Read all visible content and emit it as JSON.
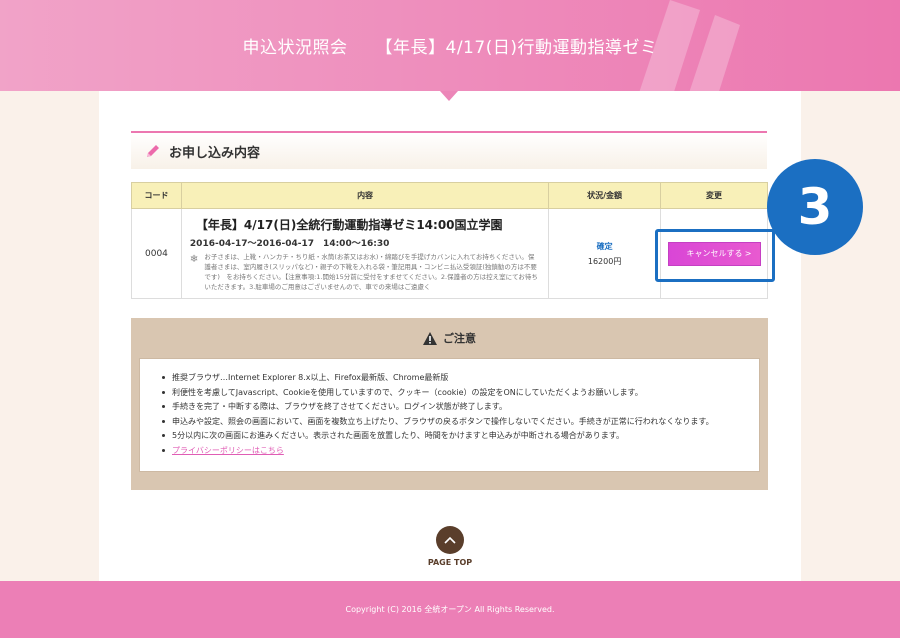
{
  "header": {
    "title_part1": "申込状況照会",
    "title_part2": "【年長】4/17(日)行動運動指導ゼミ"
  },
  "section": {
    "title": "お申し込み内容"
  },
  "table": {
    "headers": [
      "コード",
      "内容",
      "状況/金額",
      "変更"
    ],
    "rows": [
      {
        "code": "0004",
        "title": "【年長】4/17(日)全統行動運動指導ゼミ14:00国立学園",
        "date": "2016-04-17～2016-04-17　14:00～16:30",
        "note": "お子さまは、上靴・ハンカチ・ちり紙・水筒(お茶又はお水)・綿踏びを手提げカバンに入れてお持ちください。保護者さまは、室内履き(スリッパなど)・親子の下靴を入れる袋・筆記用具・コンビニ払込受領証(独鎮勧の方は不要です)　をお持ちください。【注意事項:1.開始15分前に受付をすませてください。2.保護者の方は控え室にてお待ちいただきます。3.駐車場のご用意はございませんので、車での来場はご遠慮く",
        "status": "確定",
        "amount": "16200円",
        "button_label": "キャンセルする"
      }
    ]
  },
  "badge": {
    "number": "3"
  },
  "notice": {
    "title": "ご注意",
    "items": [
      "推奨ブラウザ…Internet Explorer 8.x以上、Firefox最新版、Chrome最新版",
      "利便性を考慮してJavascript、Cookieを使用していますので、クッキー（cookie）の設定をONにしていただくようお願いします。",
      "手続きを完了・中断する際は、ブラウザを終了させてください。ログイン状態が終了します。",
      "申込みや設定、照会の画面において、画面を複数立ち上げたり、ブラウザの戻るボタンで操作しないでください。手続きが正常に行われなくなります。",
      "5分以内に次の画面にお進みください。表示された画面を放置したり、時間をかけますと申込みが中断される場合があります。"
    ],
    "privacy_link": "プライバシーポリシーはこちら"
  },
  "pagetop": {
    "label": "PAGE TOP"
  },
  "footer": {
    "copyright": "Copyright (C) 2016 全統オープン All Rights Reserved."
  },
  "colors": {
    "header_pink": "#ee8dbc",
    "accent_blue": "#1b6fc2",
    "button_magenta": "#d946d6",
    "table_header": "#f8f0b8",
    "notice_bg": "#d9c6b1",
    "footer_pink": "#ec7fb6"
  }
}
